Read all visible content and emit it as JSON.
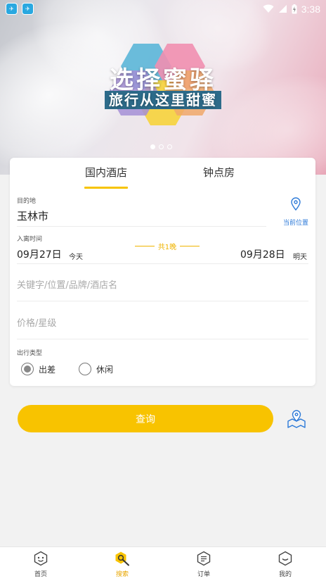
{
  "status_bar": {
    "time": "3:38"
  },
  "banner": {
    "title": "选择蜜驿",
    "subtitle": "旅行从这里甜蜜",
    "slide_count": 3,
    "active_slide": 1
  },
  "tabs": [
    {
      "label": "国内酒店",
      "active": true
    },
    {
      "label": "钟点房",
      "active": false
    }
  ],
  "destination": {
    "label": "目的地",
    "value": "玉林市",
    "location_button_label": "当前位置"
  },
  "dates": {
    "label": "入离时间",
    "checkin": "09月27日",
    "checkin_tag": "今天",
    "nights": "共1晚",
    "checkout": "09月28日",
    "checkout_tag": "明天"
  },
  "keyword": {
    "placeholder": "关键字/位置/品牌/酒店名"
  },
  "price": {
    "placeholder": "价格/星级"
  },
  "trip_type": {
    "label": "出行类型",
    "options": [
      {
        "label": "出差",
        "selected": true
      },
      {
        "label": "休闲",
        "selected": false
      }
    ]
  },
  "actions": {
    "query_label": "查询"
  },
  "bottom_nav": [
    {
      "label": "首页",
      "icon": "home-face-icon",
      "active": false
    },
    {
      "label": "搜索",
      "icon": "search-icon",
      "active": true
    },
    {
      "label": "订单",
      "icon": "order-icon",
      "active": false
    },
    {
      "label": "我的",
      "icon": "profile-icon",
      "active": false
    }
  ],
  "colors": {
    "accent": "#f8c300",
    "link": "#2d7ad8",
    "nights": "#f0b400"
  }
}
